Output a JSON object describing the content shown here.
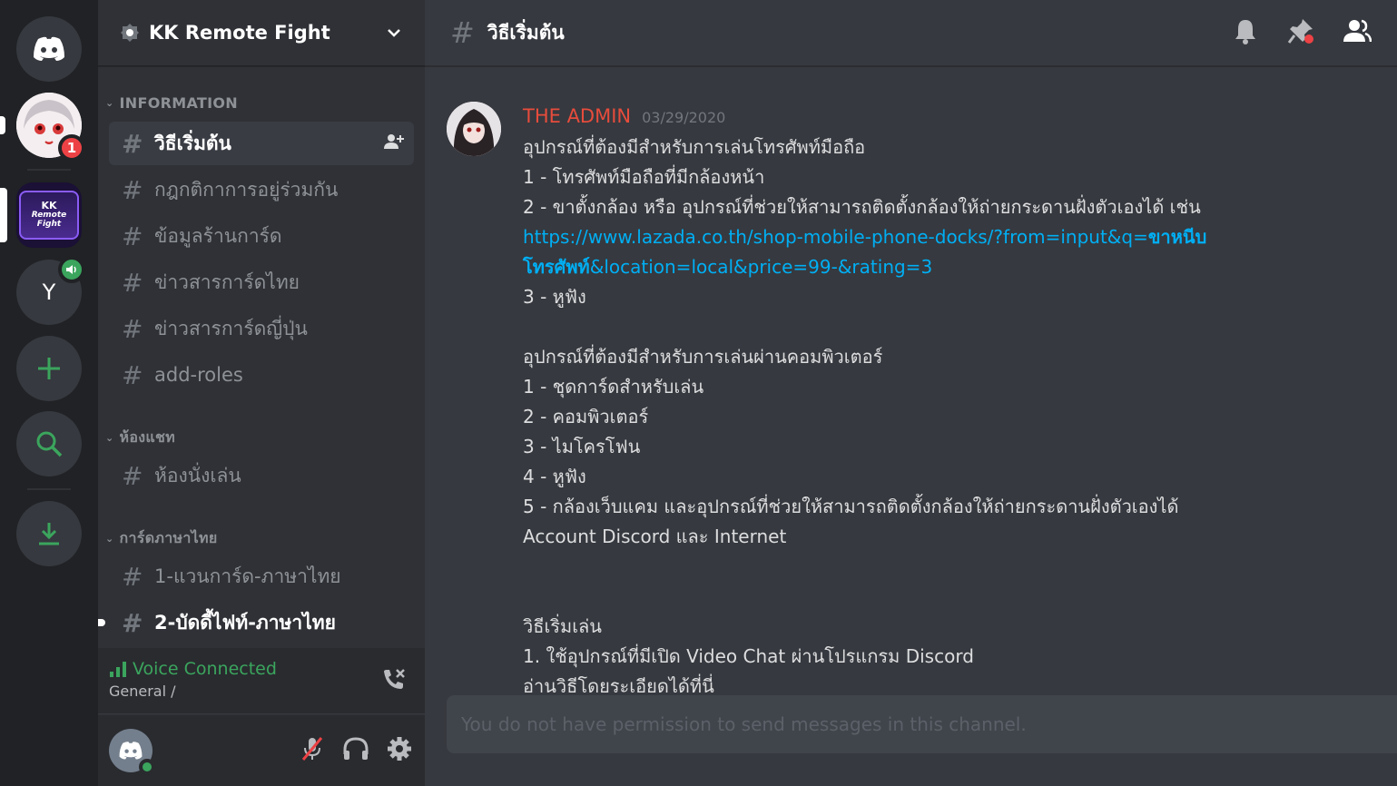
{
  "server_rail": {
    "home_icon": "discord-logo-icon",
    "notification_badge": "1",
    "kk_logo_text_1": "KK",
    "kk_logo_text_2": "Remote",
    "kk_logo_text_3": "Fight",
    "y_server_letter": "Y"
  },
  "guild": {
    "name": "KK Remote Fight"
  },
  "categories": {
    "information": "INFORMATION",
    "chat": "ห้องแชท",
    "thai_cards": "การ์ดภาษาไทย"
  },
  "channels": {
    "info": [
      "วิธีเริ่มต้น",
      "กฎกติกาการอยู่ร่วมกัน",
      "ข้อมูลร้านการ์ด",
      "ข่าวสารการ์ดไทย",
      "ข่าวสารการ์ดญี่ปุ่น",
      "add-roles"
    ],
    "chat": [
      "ห้องนั่งเล่น"
    ],
    "thai": [
      "1-แวนการ์ด-ภาษาไทย",
      "2-บัดดี้ไฟท์-ภาษาไทย"
    ]
  },
  "voice": {
    "status": "Voice Connected",
    "channel": "General /"
  },
  "channel_header": {
    "title": "วิธีเริ่มต้น"
  },
  "message": {
    "author": "THE ADMIN",
    "timestamp": "03/29/2020",
    "lines": [
      "อุปกรณ์ที่ต้องมีสำหรับการเล่นโทรศัพท์มือถือ",
      "1 - โทรศัพท์มือถือที่มีกล้องหน้า",
      "2 - ขาตั้งกล้อง หรือ อุปกรณ์ที่ช่วยให้สามารถติดตั้งกล้องให้ถ่ายกระดานฝั่งตัวเองได้ เช่น"
    ],
    "link_part1": "https://www.lazada.co.th/shop-mobile-phone-docks/?from=input&q=",
    "link_bold1": "ขาหนีบ",
    "link_bold2": "โทรศัพท์",
    "link_part2": "&location=local&price=99-&rating=3",
    "lines2": [
      "3 - หูฟัง",
      "",
      "อุปกรณ์ที่ต้องมีสำหรับการเล่นผ่านคอมพิวเตอร์",
      "1 - ชุดการ์ดสำหรับเล่น",
      "2 - คอมพิวเตอร์",
      "3 - ไมโครโฟน",
      "4 - หูฟัง",
      "5 - กล้องเว็บแคม และอุปกรณ์ที่ช่วยให้สามารถติดตั้งกล้องให้ถ่ายกระดานฝั่งตัวเองได้",
      "Account Discord และ Internet",
      "",
      "",
      "วิธีเริ่มเล่น",
      "1. ใช้อุปกรณ์ที่มีเปิด Video Chat ผ่านโปรแกรม Discord",
      "อ่านวิธีโดยระเอียดได้ที่นี่"
    ]
  },
  "composer": {
    "placeholder": "You do not have permission to send messages in this channel."
  },
  "colors": {
    "accent_green": "#3ba55d",
    "author_red": "#e74c3c",
    "link_blue": "#00aff4",
    "badge_red": "#ed4245"
  }
}
